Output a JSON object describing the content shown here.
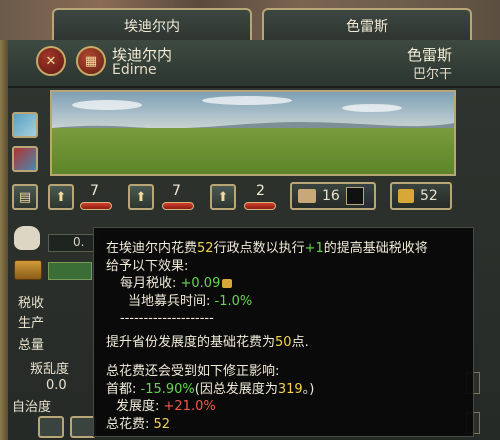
{
  "tabs": {
    "province_tab": "埃迪尔内",
    "area_tab": "色雷斯"
  },
  "header": {
    "province_name": "埃迪尔内",
    "province_latin": "Edirne",
    "area_name": "色雷斯",
    "region_name": "巴尔干"
  },
  "development": {
    "tax": "7",
    "production": "7",
    "manpower": "2",
    "buildings_slots": "16",
    "total_dev": "52"
  },
  "left_panel": {
    "tax_label": "税收",
    "production_label": "生产",
    "total_label": "总量",
    "unrest_label": "叛乱度",
    "unrest_value": "0.0",
    "autonomy_label": "自治度",
    "partial_value": "0."
  },
  "tooltip": {
    "line1_a": "在埃迪尔内花费",
    "line1_cost": "52",
    "line1_b": "行政点数以执行",
    "line1_plus": "+1",
    "line1_c": "的提高基础税收将",
    "line2": "给予以下效果:",
    "effect1_label": "每月税收: ",
    "effect1_value": "+0.09",
    "effect2_label": "当地募兵时间: ",
    "effect2_value": "-1.0%",
    "divider": "--------------------",
    "base_cost_a": "提升省份发展度的基础花费为",
    "base_cost_value": "50",
    "base_cost_b": "点.",
    "modifiers_title": "总花费还会受到如下修正影响:",
    "capital_label": "首都: ",
    "capital_value": "-15.90%",
    "capital_note_a": "(因总发展度为",
    "capital_note_value": "319",
    "capital_note_b": "。)",
    "dev_label": "发展度: ",
    "dev_value": "+21.0%",
    "total_label": "总花费: ",
    "total_value": "52"
  },
  "colors": {
    "highlight_yellow": "#f5d54a",
    "positive_green": "#63d84f",
    "negative_red": "#ef5a4c",
    "frame_gold": "#b9a676"
  }
}
